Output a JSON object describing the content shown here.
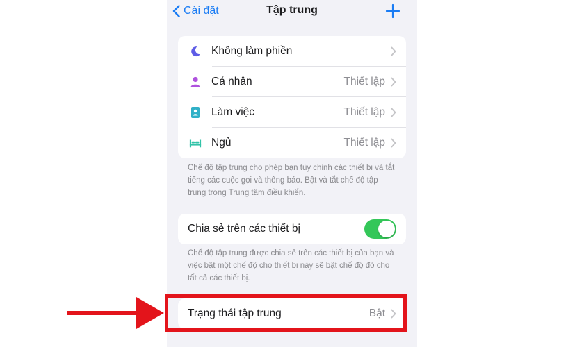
{
  "navbar": {
    "back_label": "Cài đặt",
    "title": "Tập trung"
  },
  "focus_modes": [
    {
      "label": "Không làm phiền",
      "value": "",
      "icon": "moon-icon",
      "color": "#5e5ce6"
    },
    {
      "label": "Cá nhân",
      "value": "Thiết lập",
      "icon": "person-icon",
      "color": "#af52de"
    },
    {
      "label": "Làm việc",
      "value": "Thiết lập",
      "icon": "id-badge-icon",
      "color": "#30b0c7"
    },
    {
      "label": "Ngủ",
      "value": "Thiết lập",
      "icon": "bed-icon",
      "color": "#32c3a8"
    }
  ],
  "focus_footnote": "Chế độ tập trung cho phép bạn tùy chỉnh các thiết bị và tắt tiếng các cuộc gọi và thông báo. Bật và tắt chế độ tập trung trong Trung tâm điều khiển.",
  "share": {
    "label": "Chia sẻ trên các thiết bị",
    "enabled": true,
    "footnote": "Chế độ tập trung được chia sẻ trên các thiết bị của bạn và việc bật một chế độ cho thiết bị này sẽ bật chế độ đó cho tất cả các thiết bị."
  },
  "focus_status": {
    "label": "Trạng thái tập trung",
    "value": "Bật"
  },
  "colors": {
    "accent": "#1a7cf4",
    "toggle_on": "#34c759",
    "highlight": "#e3141b",
    "background": "#f2f2f7"
  }
}
